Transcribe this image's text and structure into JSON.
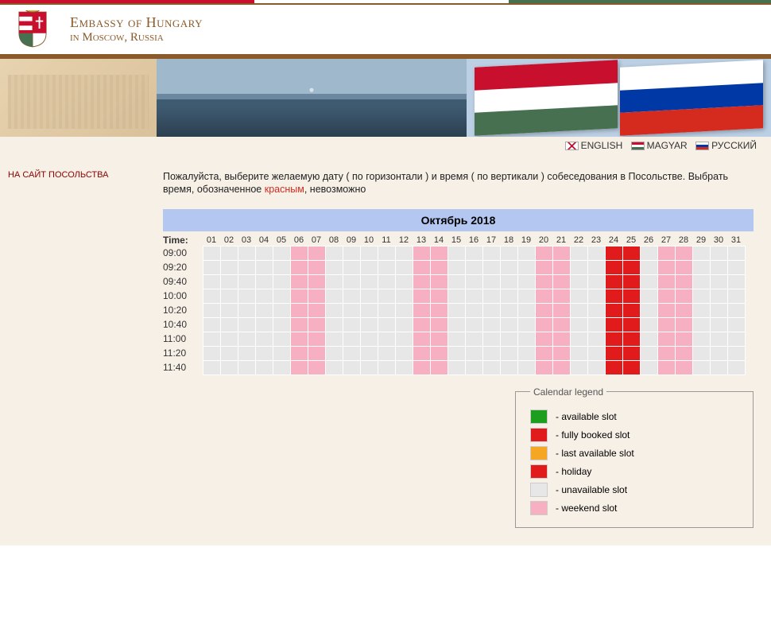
{
  "header": {
    "title_line1": "Embassy of Hungary",
    "title_line2": "in Moscow, Russia"
  },
  "languages": {
    "en": "ENGLISH",
    "hu": "MAGYAR",
    "ru": "РУССКИЙ"
  },
  "sidebar": {
    "link_text": "НА САЙТ ПОСОЛЬСТВА"
  },
  "instruction": {
    "part1": "Пожалуйста, выберите желаемую дату ( по горизонтали ) и время ( по вертикали ) собеседования в Посольстве. Выбрать время, обозначенное ",
    "red_word": "красным",
    "part2": ", невозможно"
  },
  "calendar": {
    "month_title": "Октябрь 2018",
    "time_label": "Time:",
    "days": [
      "01",
      "02",
      "03",
      "04",
      "05",
      "06",
      "07",
      "08",
      "09",
      "10",
      "11",
      "12",
      "13",
      "14",
      "15",
      "16",
      "17",
      "18",
      "19",
      "20",
      "21",
      "22",
      "23",
      "24",
      "25",
      "26",
      "27",
      "28",
      "29",
      "30",
      "31"
    ],
    "times": [
      "09:00",
      "09:20",
      "09:40",
      "10:00",
      "10:20",
      "10:40",
      "11:00",
      "11:20",
      "11:40"
    ],
    "day_status": [
      "u",
      "u",
      "u",
      "u",
      "u",
      "w",
      "w",
      "u",
      "u",
      "u",
      "u",
      "u",
      "w",
      "w",
      "u",
      "u",
      "u",
      "u",
      "u",
      "w",
      "w",
      "u",
      "u",
      "b",
      "b",
      "u",
      "w",
      "w",
      "u",
      "u",
      "u"
    ]
  },
  "legend": {
    "title": "Calendar legend",
    "available": "available slot",
    "booked": "fully booked slot",
    "last": "last available slot",
    "holiday": "holiday",
    "unavailable": "unavailable slot",
    "weekend": "weekend slot"
  }
}
